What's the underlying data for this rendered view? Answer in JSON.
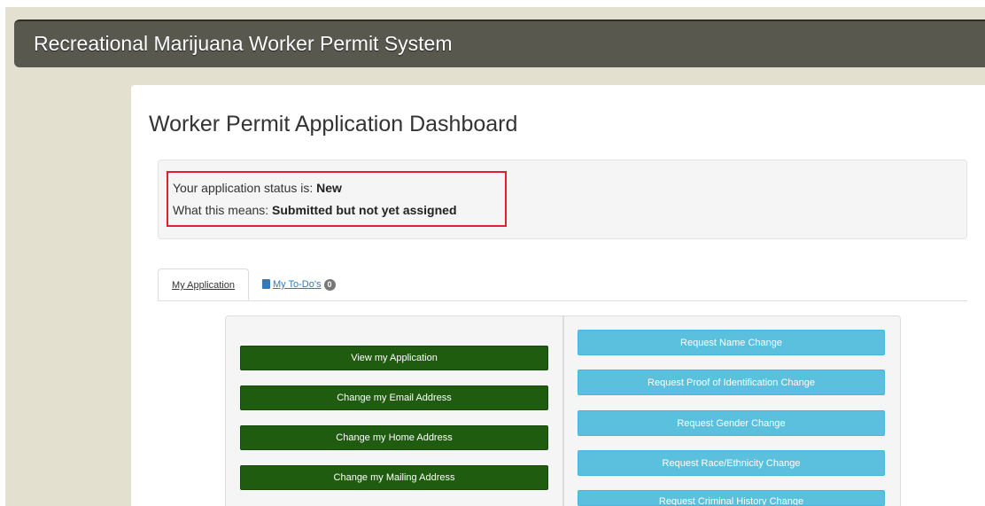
{
  "header": {
    "title": "Recreational Marijuana Worker Permit System"
  },
  "dashboard": {
    "title": "Worker Permit Application Dashboard",
    "status": {
      "prefix": "Your application status is: ",
      "value": "New",
      "meaning_prefix": "What this means: ",
      "meaning_value": "Submitted but not yet assigned"
    }
  },
  "tabs": {
    "my_application": "My Application",
    "my_todos": "My To-Do's",
    "todos_count": "0"
  },
  "actions": {
    "left": [
      "View my Application",
      "Change my Email Address",
      "Change my Home Address",
      "Change my Mailing Address"
    ],
    "right": [
      "Request Name Change",
      "Request Proof of Identification Change",
      "Request Gender Change",
      "Request Race/Ethnicity Change",
      "Request Criminal History Change"
    ]
  },
  "colors": {
    "header_bg": "#58584f",
    "page_bg": "#e3e0d0",
    "primary_green": "#1f5c10",
    "info_blue": "#5bc0de",
    "highlight_red": "#e0202c"
  },
  "icons": {
    "todo": "book-icon"
  }
}
